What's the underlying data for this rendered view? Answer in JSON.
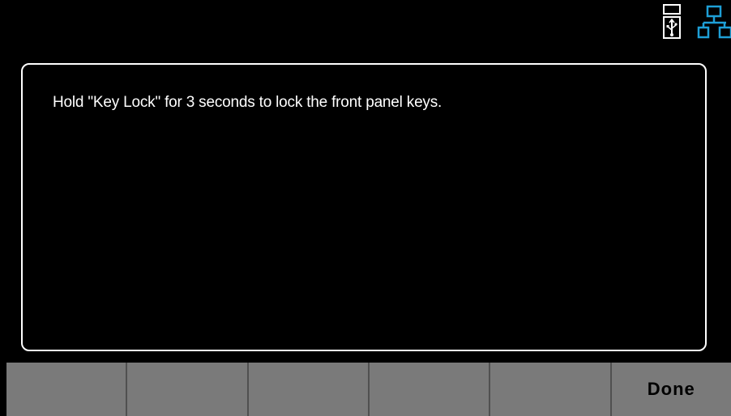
{
  "status": {
    "usb_icon": "usb-storage-icon",
    "network_icon": "lan-network-icon",
    "network_color": "#1e9fd6"
  },
  "dialog": {
    "message": "Hold \"Key Lock\" for 3 seconds to lock the front panel keys."
  },
  "softkeys": [
    {
      "label": ""
    },
    {
      "label": ""
    },
    {
      "label": ""
    },
    {
      "label": ""
    },
    {
      "label": ""
    },
    {
      "label": "Done"
    }
  ]
}
